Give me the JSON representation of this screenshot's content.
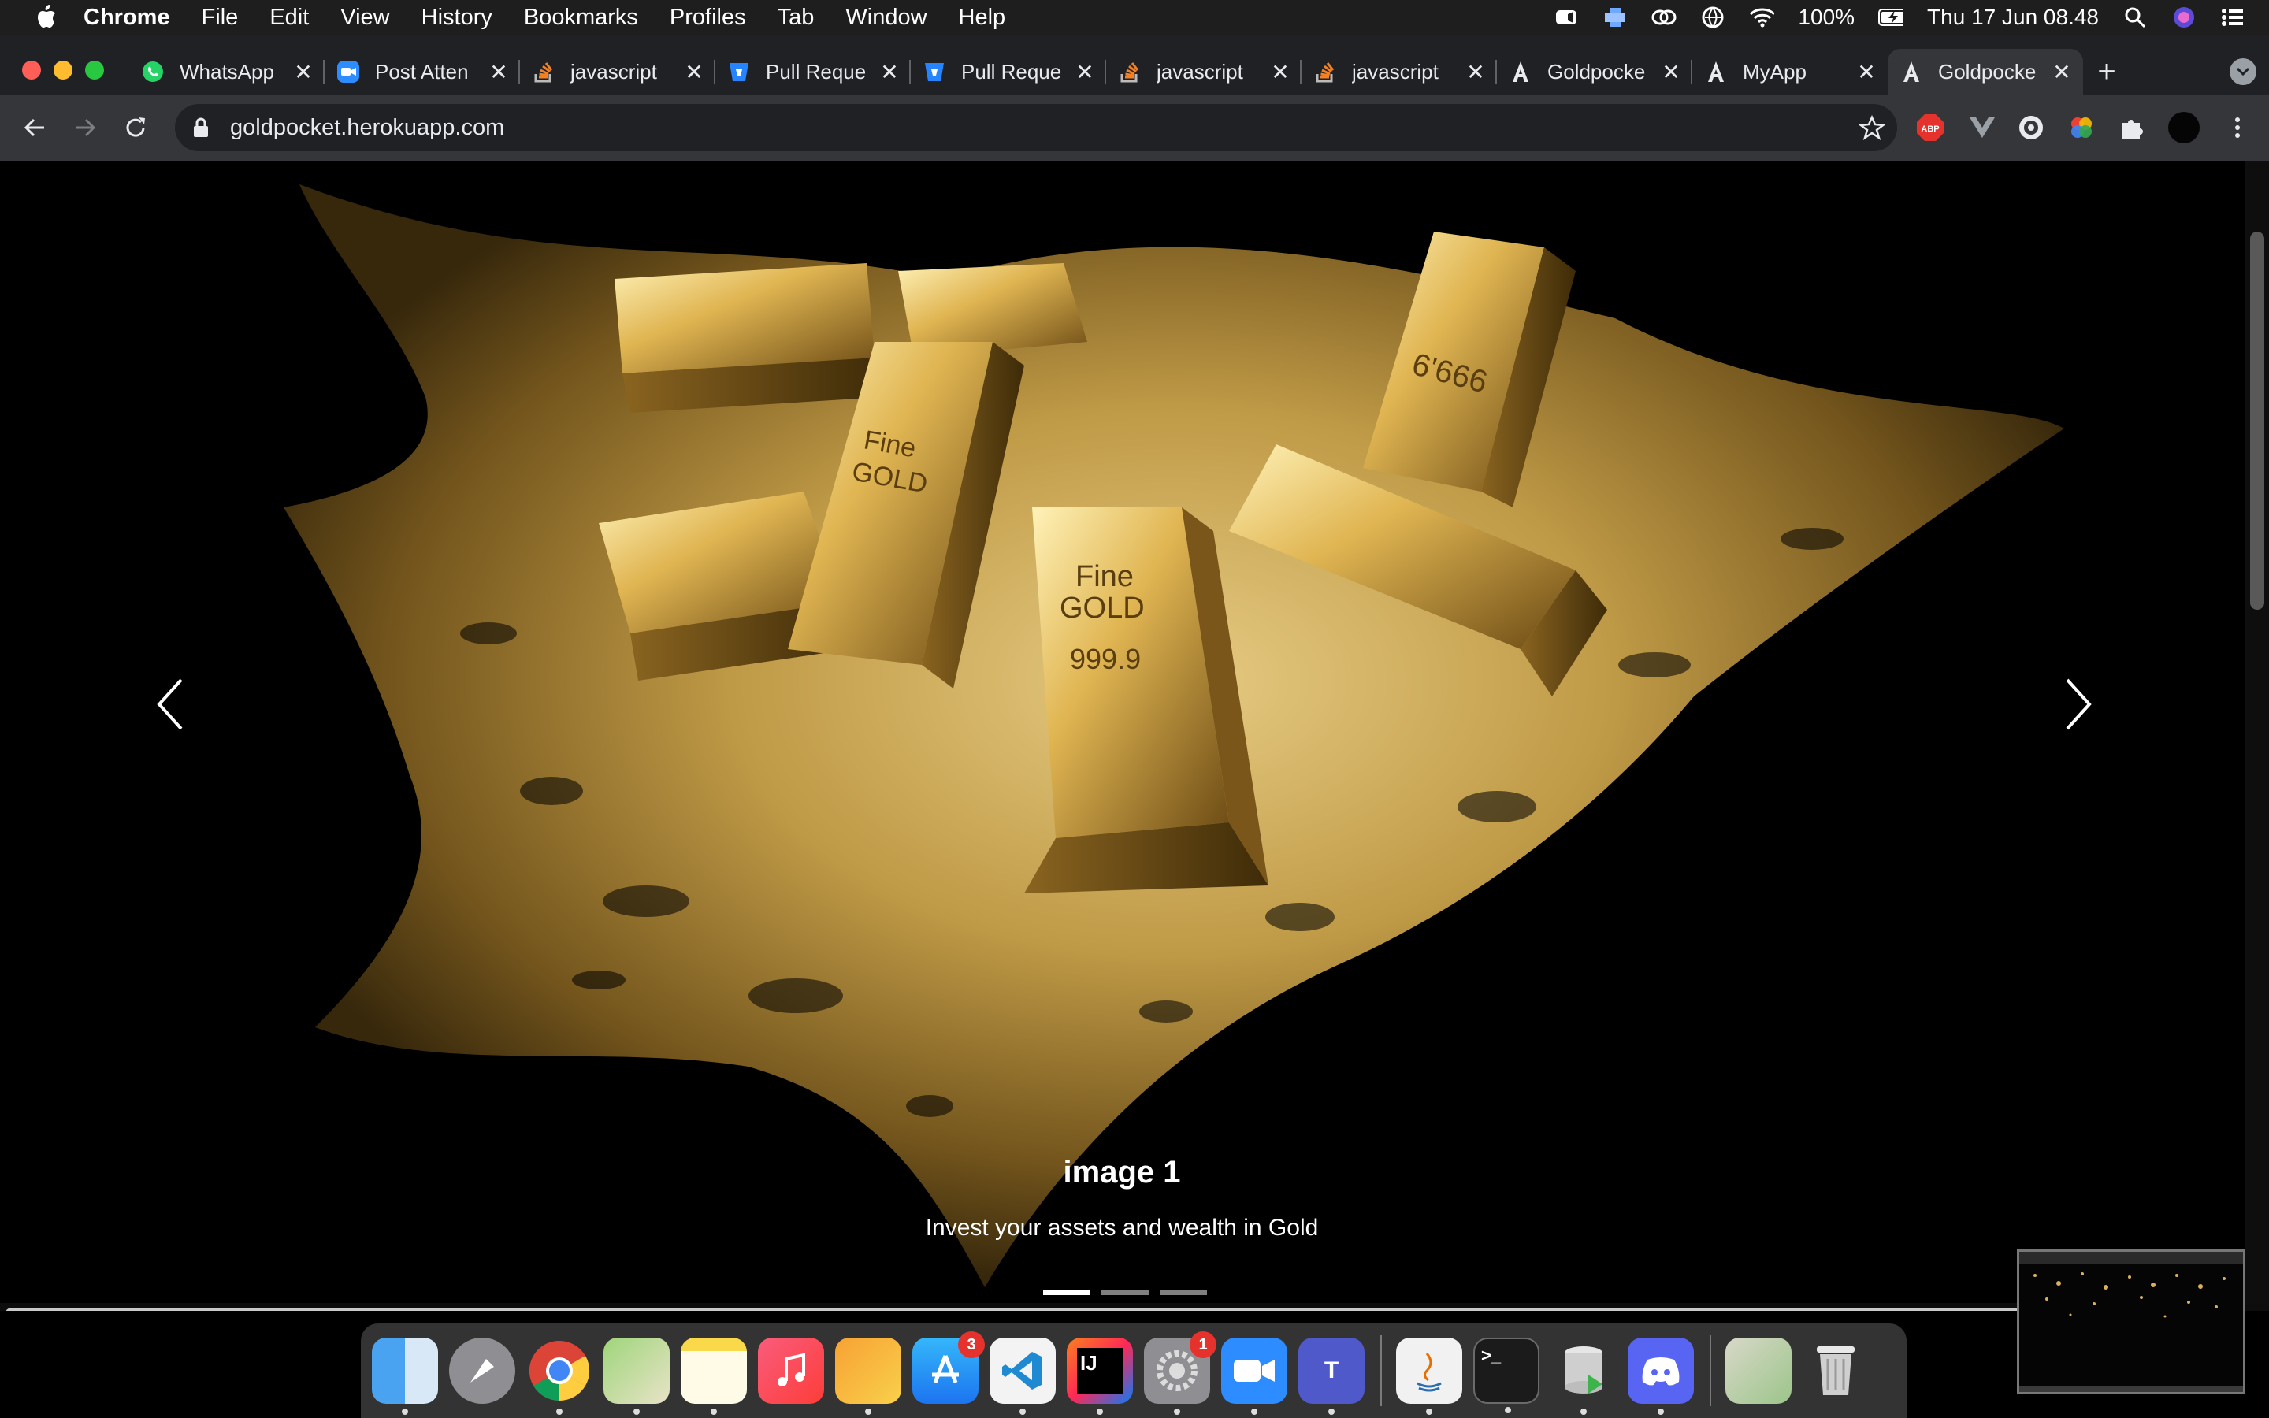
{
  "menubar": {
    "app_name": "Chrome",
    "items": [
      "File",
      "Edit",
      "View",
      "History",
      "Bookmarks",
      "Profiles",
      "Tab",
      "Window",
      "Help"
    ],
    "battery": "100%",
    "datetime": "Thu 17 Jun  08.48"
  },
  "tabs": [
    {
      "title": "WhatsApp",
      "icon": "whatsapp-icon"
    },
    {
      "title": "Post Atten",
      "icon": "zoom-icon"
    },
    {
      "title": "javascript",
      "icon": "stackoverflow-icon"
    },
    {
      "title": "Pull Reque",
      "icon": "bitbucket-icon"
    },
    {
      "title": "Pull Reque",
      "icon": "bitbucket-icon"
    },
    {
      "title": "javascript",
      "icon": "stackoverflow-icon"
    },
    {
      "title": "javascript",
      "icon": "stackoverflow-icon"
    },
    {
      "title": "Goldpocke",
      "icon": "angular-icon"
    },
    {
      "title": "MyApp",
      "icon": "angular-icon"
    },
    {
      "title": "Goldpocke",
      "icon": "angular-icon",
      "active": true
    }
  ],
  "address_bar": {
    "url": "goldpocket.herokuapp.com"
  },
  "carousel": {
    "title": "image 1",
    "text": "Invest your assets and wealth in Gold",
    "current_slide": 1,
    "total_slides": 3,
    "bar_engravings": [
      "Fine",
      "GOLD",
      "999.9",
      "6'666"
    ]
  },
  "dock": {
    "apps": [
      "Finder",
      "Launchpad",
      "Chrome",
      "Maps",
      "Notes",
      "Music",
      "Pages",
      "App Store",
      "Visual Studio Code",
      "IntelliJ IDEA",
      "System Preferences",
      "Zoom",
      "Teams",
      "Java",
      "Terminal",
      "Sequel",
      "Discord",
      "Downloads",
      "Trash"
    ],
    "app_store_badge": "3",
    "system_prefs_badge": "1",
    "ij_label": "IJ",
    "teams_label": "T",
    "terminal_label": ">_"
  },
  "colors": {
    "gold": "#c9a24a",
    "chrome_dark": "#202124",
    "chrome_toolbar": "#35363a"
  }
}
